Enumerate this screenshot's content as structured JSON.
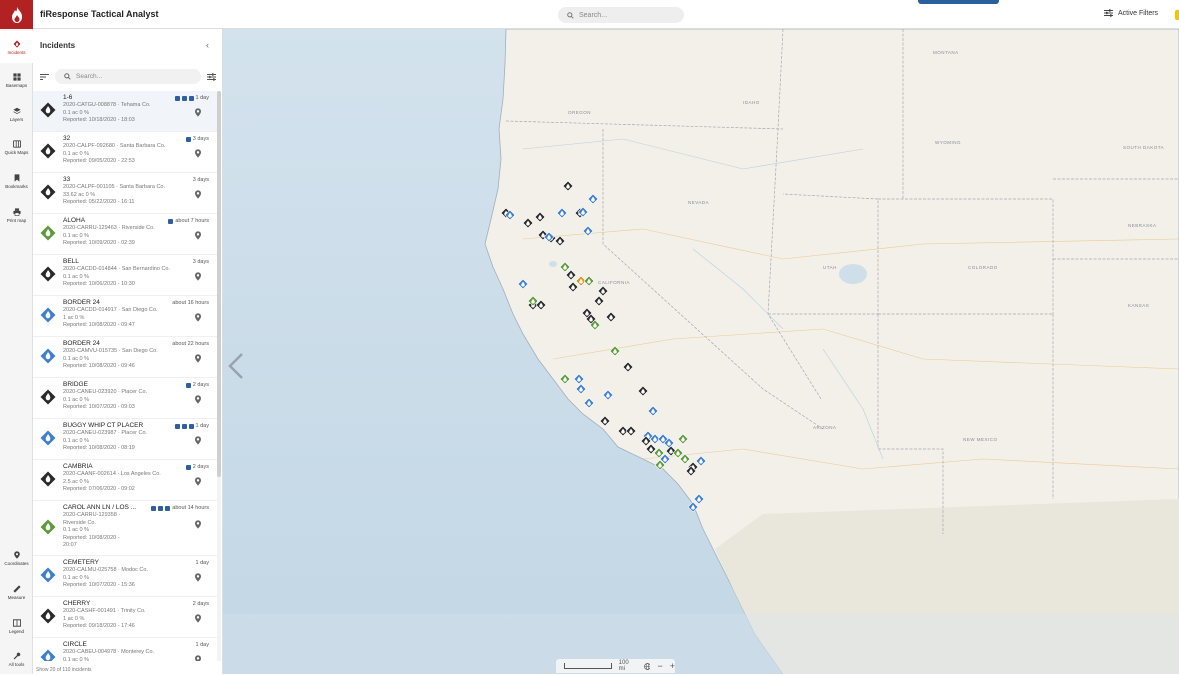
{
  "app": {
    "title": "fiResponse Tactical Analyst"
  },
  "top": {
    "search_placeholder": "Search...",
    "active_filters": "Active Filters"
  },
  "rail": {
    "items": [
      {
        "label": "Incidents",
        "icon": "flame-icon",
        "active": true
      },
      {
        "label": "Basemaps",
        "icon": "grid-icon"
      },
      {
        "label": "Layers",
        "icon": "layers-icon"
      },
      {
        "label": "Quick Maps",
        "icon": "map-icon"
      },
      {
        "label": "Bookmarks",
        "icon": "bookmark-icon"
      },
      {
        "label": "Print map",
        "icon": "printer-icon"
      }
    ],
    "bottom": [
      {
        "label": "Coordinates",
        "icon": "pin-icon"
      },
      {
        "label": "Measure",
        "icon": "ruler-icon"
      },
      {
        "label": "Legend",
        "icon": "book-icon"
      },
      {
        "label": "All tools",
        "icon": "wrench-icon"
      }
    ]
  },
  "panel": {
    "title": "Incidents",
    "search_placeholder": "Search...",
    "footer": "Show 20 of 110 incidents"
  },
  "colors": {
    "black_fire": "#2a2a2a",
    "blue_fire": "#3f7fcf",
    "green_fire": "#5c9a3a",
    "orange_fire": "#e0901e",
    "brand": "#b32222"
  },
  "incidents": [
    {
      "name": "1-6",
      "id": "2020-CATGU-008878",
      "county": "Tehama Co.",
      "size": "0.1 ac 0 %",
      "reported": "Reported: 10/18/2020 - 18:03",
      "age": "1 day",
      "color": "black",
      "badges": 3
    },
    {
      "name": "32",
      "id": "2020-CALPF-092680",
      "county": "Santa Barbara Co.",
      "size": "0.1 ac 0 %",
      "reported": "Reported: 09/05/2020 - 22:53",
      "age": "3 days",
      "color": "black",
      "badges": 1
    },
    {
      "name": "33",
      "id": "2020-CALPF-001105",
      "county": "Santa Barbara Co.",
      "size": "33.62 ac 0 %",
      "reported": "Reported: 05/22/2020 - 16:11",
      "age": "3 days",
      "color": "black",
      "badges": 0
    },
    {
      "name": "ALOHA",
      "id": "2020-CARRU-129463",
      "county": "Riverside Co.",
      "size": "0.1 ac 0 %",
      "reported": "Reported: 10/09/2020 - 02:39",
      "age": "about 7 hours",
      "color": "green",
      "badges": 1
    },
    {
      "name": "BELL",
      "id": "2020-CACDD-014844",
      "county": "San Bernardino Co.",
      "size": "0.1 ac 0 %",
      "reported": "Reported: 10/06/2020 - 10:30",
      "age": "3 days",
      "color": "black",
      "badges": 0
    },
    {
      "name": "BORDER 24",
      "id": "2020-CACDD-014917",
      "county": "San Diego Co.",
      "size": "1 ac 0 %",
      "reported": "Reported: 10/08/2020 - 09:47",
      "age": "about 16 hours",
      "color": "blue",
      "badges": 0
    },
    {
      "name": "BORDER 24",
      "id": "2020-CAMVU-015735",
      "county": "San Diego Co.",
      "size": "0.1 ac 0 %",
      "reported": "Reported: 10/08/2020 - 09:46",
      "age": "about 22 hours",
      "color": "blue",
      "badges": 0
    },
    {
      "name": "BRIDGE",
      "id": "2020-CANEU-023920",
      "county": "Placer Co.",
      "size": "0.1 ac 0 %",
      "reported": "Reported: 10/07/2020 - 09:03",
      "age": "2 days",
      "color": "black",
      "badges": 1
    },
    {
      "name": "BUGGY WHIP CT PLACER_HIL",
      "id": "2020-CANEU-023987",
      "county": "Placer Co.",
      "size": "0.1 ac 0 %",
      "reported": "Reported: 10/08/2020 - 08:19",
      "age": "1 day",
      "color": "blue",
      "badges": 3
    },
    {
      "name": "CAMBRIA",
      "id": "2020-CAANF-002614",
      "county": "Los Angeles Co.",
      "size": "2.5 ac 0 %",
      "reported": "Reported: 07/06/2020 - 09:02",
      "age": "2 days",
      "color": "black",
      "badges": 1
    },
    {
      "name": "CAROL ANN LN / LOS ...",
      "id": "2020-CARRU-129358",
      "county": "Riverside Co.",
      "size": "0.1 ac 0 %",
      "reported": "Reported: 10/08/2020 -",
      "reported2": "20:07",
      "age": "about 14 hours",
      "color": "green",
      "badges": 3,
      "tall": true
    },
    {
      "name": "CEMETERY",
      "id": "2020-CALMU-025758",
      "county": "Modoc Co.",
      "size": "0.1 ac 0 %",
      "reported": "Reported: 10/07/2020 - 15:36",
      "age": "1 day",
      "color": "blue",
      "badges": 0
    },
    {
      "name": "CHERRY",
      "id": "2020-CASHF-001491",
      "county": "Trinity Co.",
      "size": "1 ac 0 %",
      "reported": "Reported: 09/18/2020 - 17:46",
      "age": "2 days",
      "color": "black",
      "badges": 0
    },
    {
      "name": "CIRCLE",
      "id": "2020-CABEU-004978",
      "county": "Monterey Co.",
      "size": "0.1 ac 0 %",
      "reported": "",
      "age": "1 day",
      "color": "blue",
      "badges": 0
    }
  ],
  "map": {
    "states": [
      "OREGON",
      "IDAHO",
      "WYOMING",
      "NEVADA",
      "UTAH",
      "COLORADO",
      "ARIZONA",
      "NEW MEXICO",
      "NEBRASKA",
      "KANSAS",
      "CALIFORNIA",
      "SOUTH DAKOTA",
      "MONTANA"
    ],
    "scale_label": "100 mi"
  }
}
